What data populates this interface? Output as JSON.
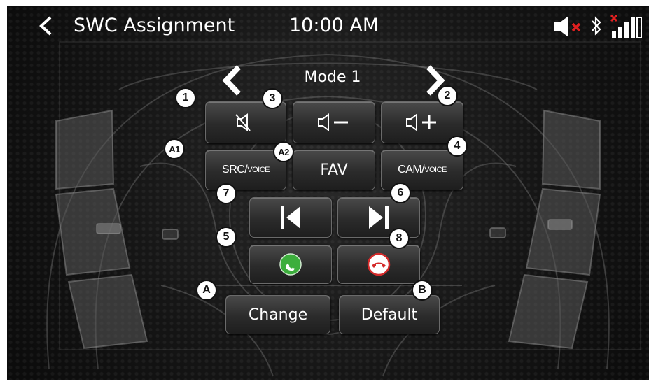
{
  "header": {
    "back_icon": "chevron-left-icon",
    "title": "SWC Assignment",
    "time": "10:00 AM",
    "status_icons": [
      "speaker-muted-icon",
      "bluetooth-icon",
      "signal-bars-no-service-icon"
    ]
  },
  "mode": {
    "label": "Mode 1",
    "prev_icon": "chevron-left-icon",
    "next_icon": "chevron-right-icon"
  },
  "keys": {
    "mute_icon": "mute-icon",
    "vol_down_icon": "volume-down-icon",
    "vol_up_icon": "volume-up-icon",
    "src_voice": {
      "main": "SRC/",
      "sub": "VOICE"
    },
    "fav": "FAV",
    "cam_voice": {
      "main": "CAM/",
      "sub": "VOICE"
    },
    "prev_track_icon": "skip-back-icon",
    "next_track_icon": "skip-forward-icon",
    "call_answer_icon": "phone-answer-icon",
    "call_end_icon": "phone-hangup-icon"
  },
  "badges": {
    "one": "1",
    "two": "2",
    "three": "3",
    "four": "4",
    "five": "5",
    "six": "6",
    "seven": "7",
    "eight": "8",
    "a1": "A1",
    "a2": "A2",
    "a": "A",
    "b": "B"
  },
  "actions": {
    "change": "Change",
    "default": "Default"
  },
  "colors": {
    "answer_green": "#3cae3c",
    "end_red": "#d42a2a",
    "mute_x_red": "#e02020"
  }
}
